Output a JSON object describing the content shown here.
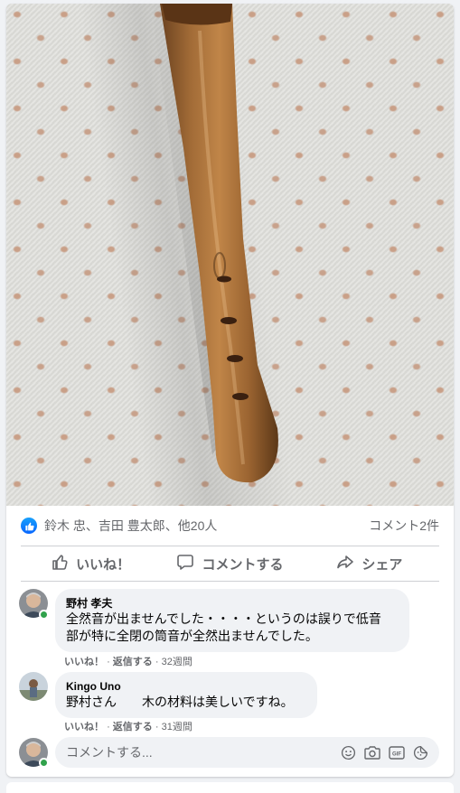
{
  "post": {
    "photo_alt": "",
    "reactions": {
      "names": "鈴木 忠、吉田 豊太郎、他20人",
      "comments_count": "コメント2件"
    },
    "actions": {
      "like": "いいね！",
      "comment": "コメントする",
      "share": "シェア"
    }
  },
  "comments": [
    {
      "author": "野村 孝夫",
      "text_line1": "全然音が出ませんでした・・・・というのは誤りで低音",
      "text_line2": "部が特に全閉の筒音が全然出ませんでした。",
      "like": "いいね！",
      "reply": "返信する",
      "time": "32週間",
      "online": true
    },
    {
      "author": "Kingo Uno",
      "text": "野村さん　　木の材料は美しいですね。",
      "like": "いいね！",
      "reply": "返信する",
      "time": "31週間",
      "online": false
    }
  ],
  "composer": {
    "placeholder": "コメントする..."
  },
  "colors": {
    "accent": "#0866ff",
    "online": "#31a24c",
    "secondary_text": "#65676b",
    "bubble": "#f0f2f5"
  },
  "icons": [
    "like-badge-icon",
    "thumbs-up-icon",
    "comment-bubble-icon",
    "share-arrow-icon",
    "emoji-icon",
    "camera-icon",
    "gif-icon",
    "sticker-icon"
  ]
}
